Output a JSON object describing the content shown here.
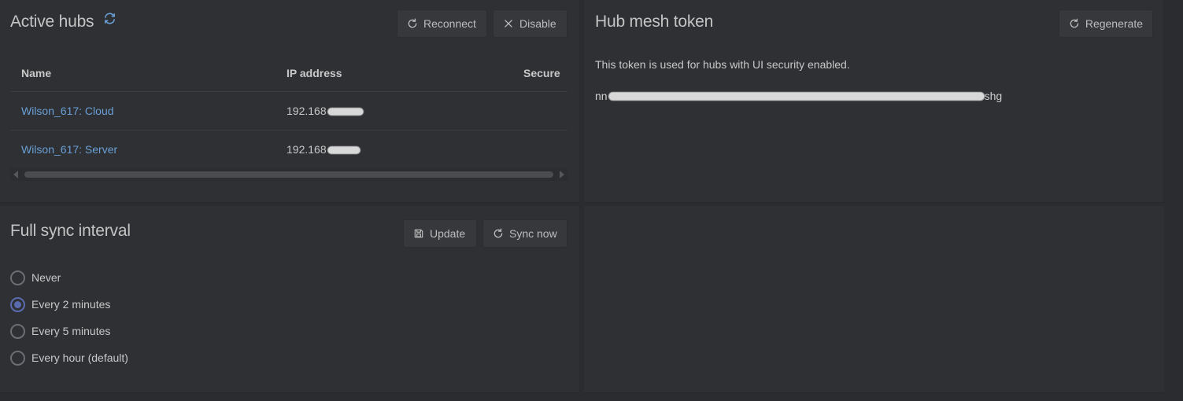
{
  "active_hubs": {
    "title": "Active hubs",
    "reconnect_label": "Reconnect",
    "disable_label": "Disable",
    "columns": [
      "Name",
      "IP address",
      "Secure"
    ],
    "rows": [
      {
        "name": "Wilson_617: Cloud",
        "ip": "192.168"
      },
      {
        "name": "Wilson_617: Server",
        "ip": "192.168"
      }
    ]
  },
  "token": {
    "title": "Hub mesh token",
    "regenerate_label": "Regenerate",
    "description": "This token is used for hubs with UI security enabled.",
    "value_prefix": "nn",
    "value_suffix": "shg"
  },
  "sync": {
    "title": "Full sync interval",
    "update_label": "Update",
    "sync_now_label": "Sync now",
    "options": [
      {
        "label": "Never",
        "checked": false
      },
      {
        "label": "Every 2 minutes",
        "checked": true
      },
      {
        "label": "Every 5 minutes",
        "checked": false
      },
      {
        "label": "Every hour (default)",
        "checked": false
      }
    ]
  },
  "colors": {
    "accent": "#5b6bb0",
    "link": "#6a9fd6",
    "card": "#2e3033",
    "background": "#2a2c2f"
  }
}
